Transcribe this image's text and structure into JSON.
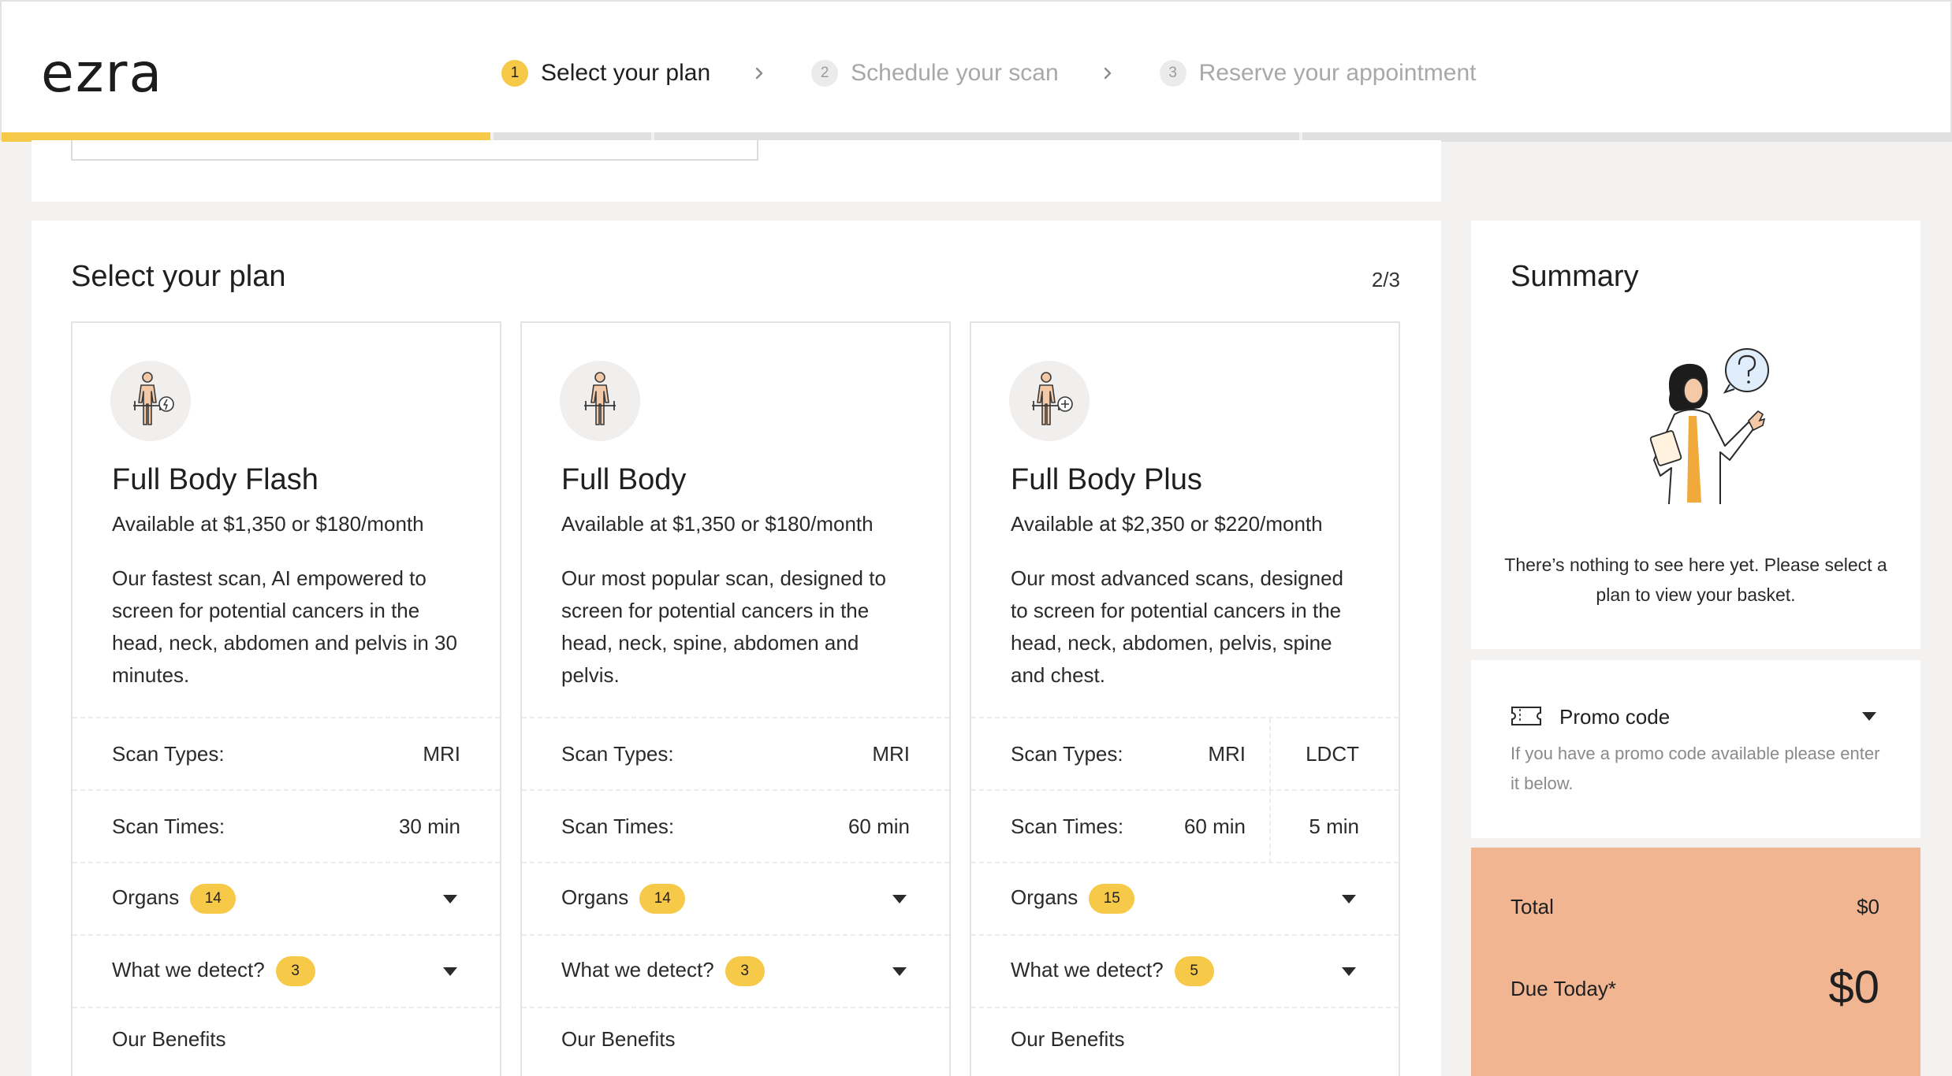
{
  "brand": {
    "logo_text": "ezra",
    "accent": "#f7c948",
    "summary_bg": "#f2b591"
  },
  "steps": [
    {
      "num": "1",
      "label": "Select your plan",
      "state": "active"
    },
    {
      "num": "2",
      "label": "Schedule your scan",
      "state": "upcoming"
    },
    {
      "num": "3",
      "label": "Reserve your appointment",
      "state": "upcoming"
    }
  ],
  "main": {
    "title": "Select your plan",
    "page_count": "2/3"
  },
  "plans": [
    {
      "name": "Full Body Flash",
      "icon": "body-scan-flash-icon",
      "price": "Available at $1,350 or $180/month",
      "description": "Our fastest scan, AI empowered to screen for potential cancers in the head, neck, abdomen and pelvis in 30 minutes.",
      "scan_types_label": "Scan Types:",
      "scan_types": [
        "MRI"
      ],
      "scan_times_label": "Scan Times:",
      "scan_times": [
        "30 min"
      ],
      "organs_label": "Organs",
      "organs_count": "14",
      "detect_label": "What we detect?",
      "detect_count": "3",
      "benefits_label": "Our Benefits"
    },
    {
      "name": "Full Body",
      "icon": "body-scan-icon",
      "price": "Available at $1,350 or $180/month",
      "description": "Our most popular scan, designed to screen for potential cancers in the head, neck, spine, abdomen and pelvis.",
      "scan_types_label": "Scan Types:",
      "scan_types": [
        "MRI"
      ],
      "scan_times_label": "Scan Times:",
      "scan_times": [
        "60 min"
      ],
      "organs_label": "Organs",
      "organs_count": "14",
      "detect_label": "What we detect?",
      "detect_count": "3",
      "benefits_label": "Our Benefits"
    },
    {
      "name": "Full Body Plus",
      "icon": "body-scan-plus-icon",
      "price": "Available at $2,350 or $220/month",
      "description": "Our most advanced scans, designed to screen for potential cancers in the head, neck, abdomen, pelvis, spine and chest.",
      "scan_types_label": "Scan Types:",
      "scan_types": [
        "MRI",
        "LDCT"
      ],
      "scan_times_label": "Scan Times:",
      "scan_times": [
        "60 min",
        "5 min"
      ],
      "organs_label": "Organs",
      "organs_count": "15",
      "detect_label": "What we detect?",
      "detect_count": "5",
      "benefits_label": "Our Benefits"
    }
  ],
  "summary": {
    "title": "Summary",
    "empty_text": "There’s nothing to see here yet. Please select a plan to view your basket.",
    "promo_label": "Promo code",
    "promo_help": "If you have a promo code available please enter it below.",
    "total_label": "Total",
    "total_value": "$0",
    "due_label": "Due Today*",
    "due_value": "$0"
  }
}
